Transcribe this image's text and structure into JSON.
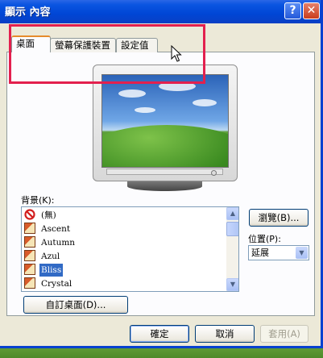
{
  "window": {
    "title": "顯示 內容",
    "help_label": "?",
    "close_label": "✕"
  },
  "tabs": [
    {
      "label": "桌面",
      "active": true
    },
    {
      "label": "螢幕保護裝置",
      "active": false
    },
    {
      "label": "設定值",
      "active": false
    }
  ],
  "background": {
    "label": "背景(K):",
    "items": [
      {
        "label": "(無)",
        "icon": "none-icon"
      },
      {
        "label": "Ascent",
        "icon": "image-file-icon"
      },
      {
        "label": "Autumn",
        "icon": "image-file-icon"
      },
      {
        "label": "Azul",
        "icon": "image-file-icon"
      },
      {
        "label": "Bliss",
        "icon": "image-file-icon",
        "selected": true
      },
      {
        "label": "Crystal",
        "icon": "image-file-icon"
      }
    ]
  },
  "browse_label": "瀏覽(B)...",
  "position": {
    "label": "位置(P):",
    "value": "延展"
  },
  "customize_label": "自訂桌面(D)...",
  "buttons": {
    "ok": "確定",
    "cancel": "取消",
    "apply": "套用(A)"
  },
  "colors": {
    "highlight": "#e3204e",
    "selection": "#316ac5",
    "active_tab_accent": "#e68b2c"
  }
}
